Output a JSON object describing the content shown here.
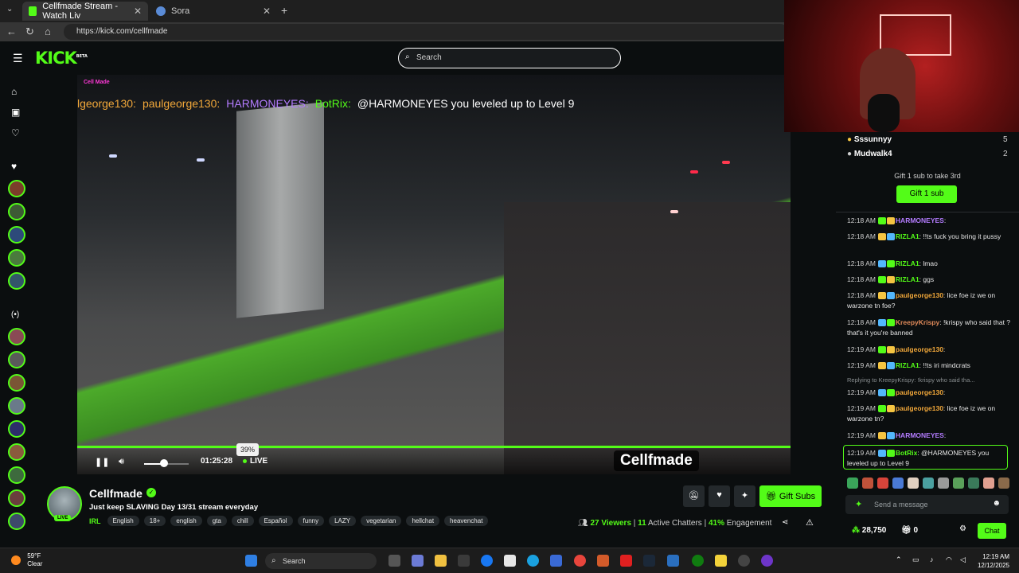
{
  "browser": {
    "tabs": [
      {
        "label": "Cellfmade Stream - Watch Liv"
      },
      {
        "label": "Sora"
      }
    ],
    "url": "https://kick.com/cellfmade"
  },
  "header": {
    "logo": "KICK",
    "logo_tag": "BETA",
    "search_placeholder": "Search"
  },
  "video": {
    "overlay_label": "Cell Made",
    "overlay_chat": [
      {
        "text": "lgeorge130:",
        "color": "#f2a83a"
      },
      {
        "text": "paulgeorge130:",
        "color": "#f2a83a"
      },
      {
        "text": "HARMONEYES:",
        "color": "#b47cff"
      },
      {
        "text": "BotRix:",
        "color": "#53fc18"
      },
      {
        "text": "@HARMONEYES you leveled up to Level 9",
        "color": "#ffffff"
      }
    ],
    "volume_percent": 39,
    "volume_label": "39%",
    "time": "01:25:28",
    "live_label": "LIVE",
    "watermark": "Cellfmade"
  },
  "chat": {
    "leaderboard": [
      {
        "name": "Sssunnyy",
        "count": "5"
      },
      {
        "name": "Mudwalk4",
        "count": "2"
      }
    ],
    "gift_note": "Gift 1 sub to take 3rd",
    "gift_button": "Gift 1 sub",
    "messages": [
      {
        "time": "12:18 AM",
        "user": "HARMONEYES",
        "user_color": "#b47cff",
        "text": ""
      },
      {
        "time": "12:18 AM",
        "user": "RIZLA1",
        "user_color": "#53fc18",
        "text": "!!ts fuck you bring it pussy"
      },
      {
        "time": "12:18 AM",
        "user": "RIZLA1",
        "user_color": "#53fc18",
        "text": "lmao"
      },
      {
        "time": "12:18 AM",
        "user": "RIZLA1",
        "user_color": "#53fc18",
        "text": "ggs"
      },
      {
        "time": "12:18 AM",
        "user": "paulgeorge130",
        "user_color": "#f2a83a",
        "text": "lice foe iz we on warzone tn foe?"
      },
      {
        "time": "12:18 AM",
        "user": "KreepyKrispy",
        "user_color": "#e08a5a",
        "text": "!krispy who said that ? that's it you're banned"
      },
      {
        "time": "12:19 AM",
        "user": "paulgeorge130",
        "user_color": "#f2a83a",
        "text": ""
      },
      {
        "time": "12:19 AM",
        "user": "RIZLA1",
        "user_color": "#53fc18",
        "text": "!!ts iri mindcrats"
      },
      {
        "time": "12:19 AM",
        "user": "paulgeorge130",
        "user_color": "#f2a83a",
        "text": ""
      },
      {
        "time": "12:19 AM",
        "user": "paulgeorge130",
        "user_color": "#f2a83a",
        "text": "lice foe iz we on warzone tn?"
      },
      {
        "time": "12:19 AM",
        "user": "HARMONEYES",
        "user_color": "#b47cff",
        "text": ""
      },
      {
        "time": "12:19 AM",
        "user": "BotRix",
        "user_color": "#53fc18",
        "text": "@HARMONEYES you leveled up to Level 9"
      }
    ],
    "reply_note": "Replying to KreepyKrispy: !krispy who said tha...",
    "send_placeholder": "Send a message",
    "points": "28,750",
    "gifts": "0",
    "chat_button": "Chat"
  },
  "streamer": {
    "name": "Cellfmade",
    "live_badge": "LIVE",
    "title": "Just keep SLAVING Day 13/31 stream everyday",
    "category": "IRL",
    "tags": [
      "English",
      "18+",
      "english",
      "gta",
      "chill",
      "Español",
      "funny",
      "LAZY",
      "vegetarian",
      "hellchat",
      "heavenchat"
    ],
    "gift_subs_button": "Gift Subs",
    "viewers": "27",
    "viewers_label": "Viewers",
    "chatters": "11",
    "chatters_label": "Active Chatters",
    "engagement": "41%",
    "engagement_label": "Engagement"
  },
  "taskbar": {
    "temperature": "59°F",
    "condition": "Clear",
    "search_label": "Search",
    "time": "12:19 AM",
    "date": "12/12/2025"
  },
  "colors": {
    "kick_green": "#53fc18",
    "background": "#0b0e0f"
  }
}
